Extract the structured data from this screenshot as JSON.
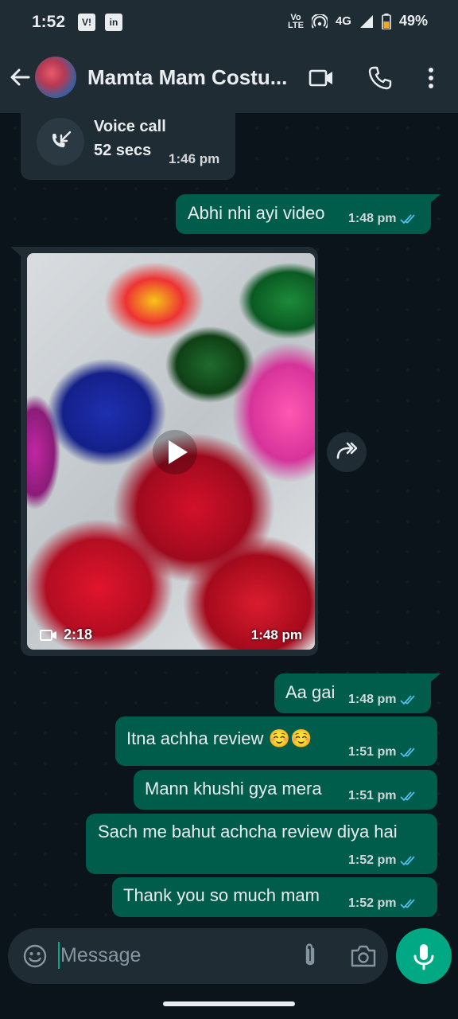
{
  "status_bar": {
    "time": "1:52",
    "left_badges": [
      "V!",
      "in"
    ],
    "volte_label": "Vo\nLTE",
    "network": "4G",
    "battery": "49%"
  },
  "header": {
    "contact_name": "Mamta Mam Costu...",
    "icons": [
      "back-arrow-icon",
      "avatar",
      "video-call-icon",
      "phone-icon",
      "more-options-icon"
    ]
  },
  "messages": {
    "call": {
      "title": "Voice call",
      "duration": "52 secs",
      "time": "1:46 pm"
    },
    "m1": {
      "text": "Abhi nhi ayi video",
      "time": "1:48 pm"
    },
    "video": {
      "duration": "2:18",
      "time": "1:48 pm"
    },
    "m2": {
      "text": "Aa gai",
      "time": "1:48 pm"
    },
    "m3": {
      "text": "Itna achha review ☺️☺️",
      "time": "1:51 pm"
    },
    "m4": {
      "text": "Mann khushi gya mera",
      "time": "1:51 pm"
    },
    "m5": {
      "text": "Sach me bahut achcha review diya hai",
      "time": "1:52 pm"
    },
    "m6": {
      "text": "Thank you so much mam",
      "time": "1:52 pm"
    }
  },
  "composer": {
    "placeholder": "Message"
  },
  "colors": {
    "outgoing": "#005c4b",
    "incoming": "#202c33",
    "accent": "#00a884",
    "read_ticks": "#53bdeb"
  }
}
